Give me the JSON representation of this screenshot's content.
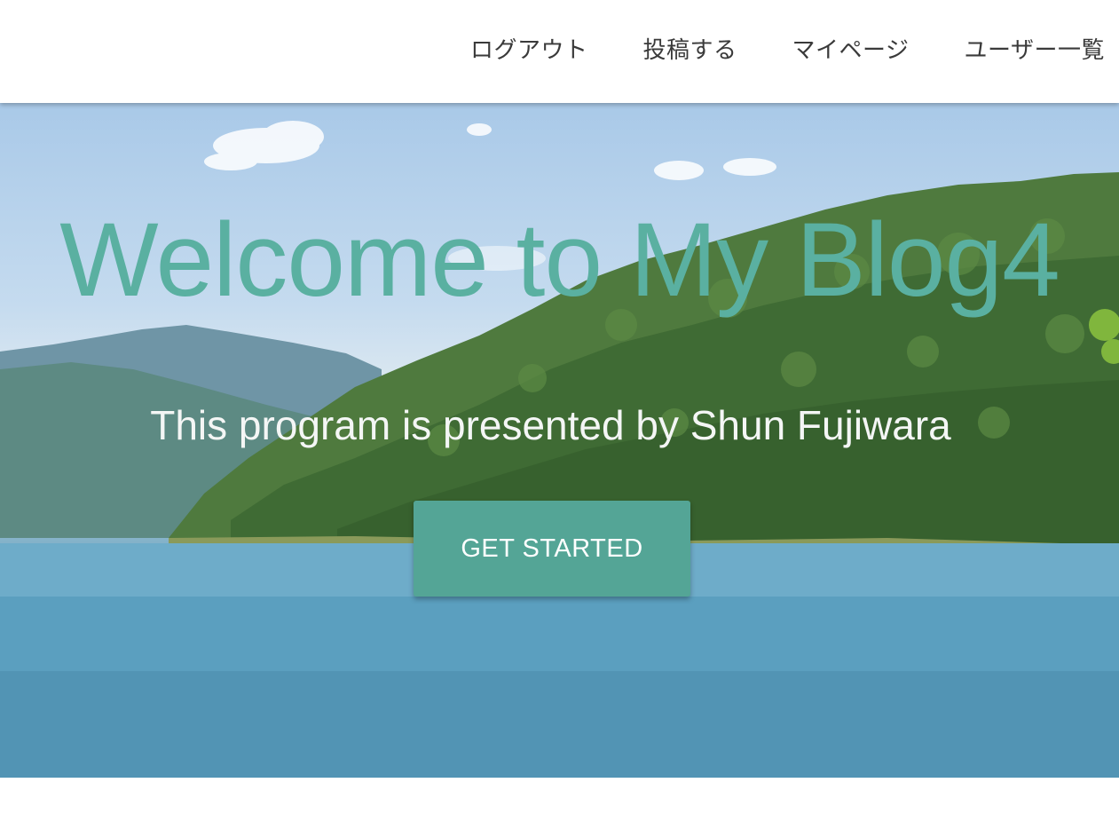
{
  "nav": {
    "items": [
      {
        "label": "ログアウト"
      },
      {
        "label": "投稿する"
      },
      {
        "label": "マイページ"
      },
      {
        "label": "ユーザー一覧"
      }
    ]
  },
  "hero": {
    "title": "Welcome to My Blog4",
    "subtitle": "This program is presented by Shun Fujiwara",
    "cta_label": "GET STARTED",
    "background": "lake-and-mountains-photo"
  },
  "colors": {
    "title": "#5ab0a1",
    "cta_background": "#54a596",
    "nav_text": "#3a3a3a"
  }
}
